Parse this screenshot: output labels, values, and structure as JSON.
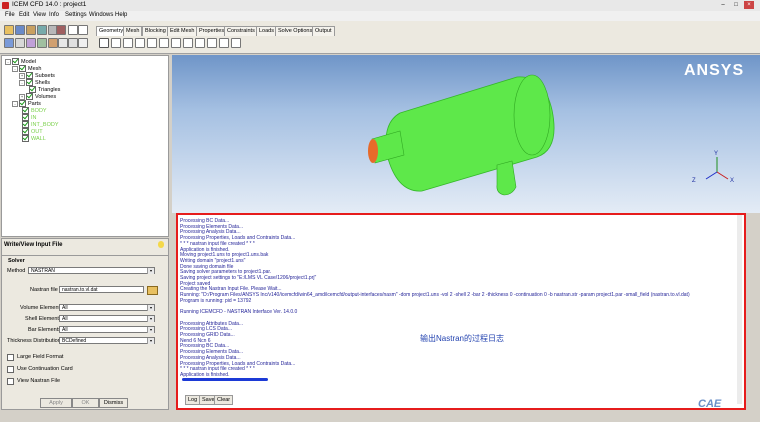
{
  "window": {
    "title": "ICEM CFD 14.0 : project1"
  },
  "menu": [
    "File",
    "Edit",
    "View",
    "Info",
    "Settings",
    "Windows",
    "Help"
  ],
  "tabs": [
    "Geometry",
    "Mesh",
    "Blocking",
    "Edit Mesh",
    "Properties",
    "Constraints",
    "Loads",
    "Solve Options",
    "Output"
  ],
  "tree": {
    "model": "Model",
    "mesh": "Mesh",
    "subsets": "Subsets",
    "shells": "Shells",
    "triangles": "Triangles",
    "volumes": "Volumes",
    "parts": "Parts",
    "part_list": [
      "BODY",
      "IN",
      "INT_BODY",
      "OUT",
      "WALL"
    ]
  },
  "panel": {
    "title": "Write/View Input File",
    "solver_label": "Solver",
    "method_label": "Method",
    "method_value": "NASTRAN",
    "nastran_file_label": "Nastran file",
    "nastran_file_value": "nastran.to.vl.dat",
    "volume_elements_label": "Volume Elements",
    "volume_elements_value": "All",
    "shell_elements_label": "Shell Elements",
    "shell_elements_value": "All",
    "bar_elements_label": "Bar Elements",
    "bar_elements_value": "All",
    "thickness_label": "Thickness Distribution",
    "thickness_value": "BCDefined",
    "large_field_label": "Large Field Format",
    "use_continuation_label": "Use Continuation Card",
    "view_nastran_label": "View Nastran File",
    "apply": "Apply",
    "ok": "OK",
    "dismiss": "Dismiss"
  },
  "viewport": {
    "logo": "ANSYS",
    "model_color": "#5ee84a",
    "inlet_color": "#e66a2a",
    "axis_x": "X",
    "axis_y": "Y",
    "axis_z": "Z"
  },
  "log": {
    "lines": [
      "Processing BC Data...",
      "Processing Elements Data...",
      "Processing Analysis Data...",
      "Processing Properties, Loads and Contraints Data...",
      "* * * nastran input file created * * *",
      "Application is finished.",
      "Moving project1.uns to project1.uns.bak",
      "Writing domain \"project1.uns\"",
      "Done saving domain file",
      "Saving solver parameters to project1.par.",
      "Saving project settings to \"E:/LMS VL Case/1206/project1.prj\"",
      "Project saved",
      "Creating the Nastran Input File.  Please Wait...",
      "Running: \"D:/Program Files/ANSYS Inc/v140/icemcfd/win64_amd/icemcfd/output-interfaces/nasm\" -dom project1.uns -vol 2 -shell 2 -bar 2 -thickness 0 -continuation 0 -b nastran.str -param project1.par -small_field (nastran.to.vl.dat)",
      "Program is running: pid = 13792",
      "",
      "  Running ICEMCFD - NASTRAN Interface Ver. 14.0.0",
      "",
      "Processing Attributes Data...",
      "Processing LCS Data...",
      "Processing GRID Data...",
      "Nend 6 Ncn 6",
      "Processing BC Data...",
      "Processing Elements Data...",
      "Processing Analysis Data...",
      "Processing Properties, Loads and Contraints Data...",
      "* * * nastran input file created * * *",
      "Application is finished."
    ],
    "annotation": "输出Nastran的过程日志",
    "log_button": "Log",
    "save_button": "Save",
    "clear_button": "Clear"
  },
  "watermark": "CAE"
}
